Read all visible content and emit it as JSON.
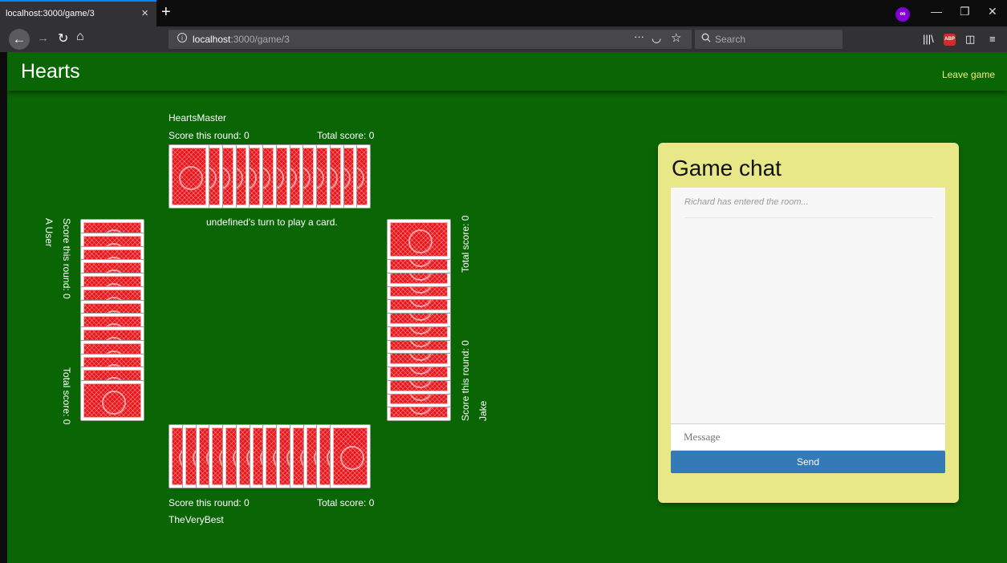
{
  "browser": {
    "tab_title": "localhost:3000/game/3",
    "tab_close": "×",
    "new_tab": "+",
    "url_host": "localhost",
    "url_path": ":3000/game/3",
    "search_placeholder": "Search",
    "page_actions": "···",
    "private_mask": "∞",
    "abp": "ABP"
  },
  "header": {
    "title": "Hearts",
    "leave": "Leave game"
  },
  "status": "undefined's turn to play a card.",
  "players": {
    "top": {
      "name": "HeartsMaster",
      "round": "Score this round: 0",
      "total": "Total score: 0",
      "cards": 13
    },
    "bottom": {
      "name": "TheVeryBest",
      "round": "Score this round: 0",
      "total": "Total score: 0",
      "cards": 13
    },
    "left": {
      "name": "A User",
      "round": "Score this round: 0",
      "total": "Total score: 0",
      "cards": 13
    },
    "right": {
      "name": "Jake",
      "round": "Score this round: 0",
      "total": "Total score: 0",
      "cards": 13
    }
  },
  "chat": {
    "title": "Game chat",
    "messages": [
      "Richard has entered the room..."
    ],
    "placeholder": "Message",
    "send": "Send"
  },
  "colors": {
    "felt": "#0a6605",
    "card_back": "#e8151b",
    "chat_panel": "#e8e889",
    "send_button": "#337ab7",
    "leave_link": "#f0f17a"
  }
}
